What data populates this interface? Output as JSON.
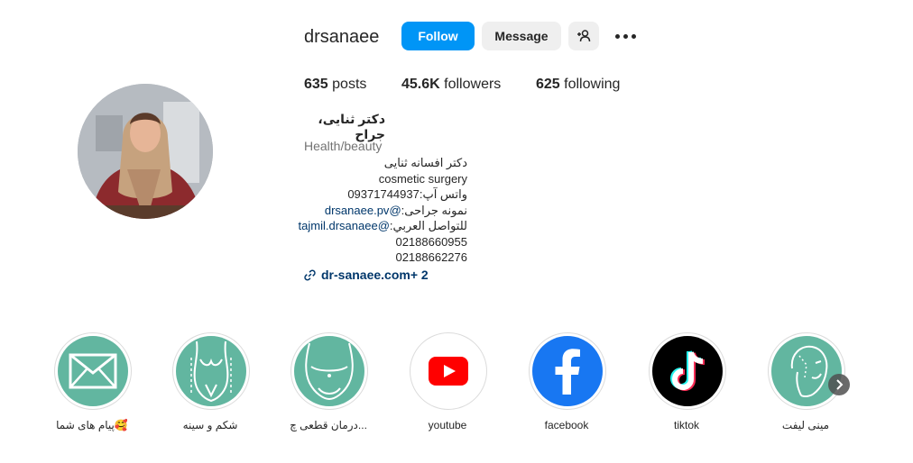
{
  "profile": {
    "username": "drsanaee",
    "follow_label": "Follow",
    "message_label": "Message",
    "stats": {
      "posts_count": "635",
      "posts_label": "posts",
      "followers_count": "45.6K",
      "followers_label": "followers",
      "following_count": "625",
      "following_label": "following"
    },
    "full_name": "دکتر ثنایی، جراح",
    "category": "Health/beauty",
    "bio": {
      "line1": "دکتر افسانه ثنایی",
      "line2": "cosmetic surgery",
      "line3": "واتس آپ:09371744937",
      "line4_prefix": "نمونه جراحی:",
      "line4_mention": "@drsanaee.pv",
      "line5_prefix": "للتواصل العربي:",
      "line5_mention": "@tajmil.drsanaee",
      "line6": "02188660955",
      "line7": "02188662276"
    },
    "link": {
      "text": "dr-sanaee.com",
      "extra": " + 2"
    }
  },
  "highlights": [
    {
      "label": "پیام های شما🥰",
      "icon": "envelope-icon"
    },
    {
      "label": "شکم و سینه",
      "icon": "torso-outline-icon"
    },
    {
      "label": "درمان قطعی چ...",
      "icon": "belly-outline-icon"
    },
    {
      "label": "youtube",
      "icon": "youtube-icon"
    },
    {
      "label": "facebook",
      "icon": "facebook-icon"
    },
    {
      "label": "tiktok",
      "icon": "tiktok-icon"
    },
    {
      "label": "مینی لیفت",
      "icon": "face-lift-icon"
    }
  ],
  "colors": {
    "follow_button": "#0095f6",
    "secondary_button": "#efefef",
    "highlight_teal": "#62b6a0",
    "youtube_red": "#ff0000",
    "facebook_blue": "#1877f2",
    "link_color": "#00376b"
  }
}
